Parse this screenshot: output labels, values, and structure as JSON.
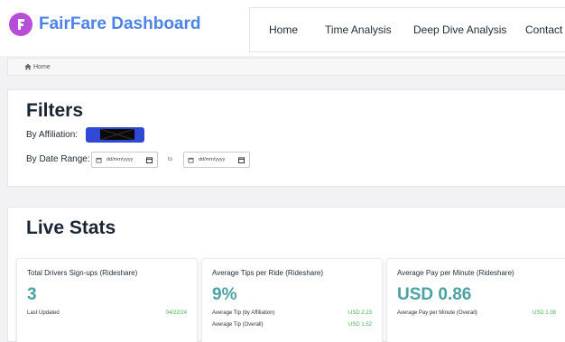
{
  "brand": {
    "name": "FairFare Dashboard",
    "logo_color": "#b84dd8",
    "name_color": "#4c83e6"
  },
  "nav": {
    "home": "Home",
    "time_analysis": "Time Analysis",
    "deep_dive": "Deep Dive Analysis",
    "contact": "Contact"
  },
  "breadcrumb": {
    "home": "Home"
  },
  "filters": {
    "title": "Filters",
    "affiliation_label": "By Affiliation:",
    "date_range_label": "By Date Range:",
    "date_from_placeholder": "dd/mm/yyyy",
    "to_label": "to",
    "date_to_placeholder": "dd/mm/yyyy",
    "affiliation_select_color": "#2f49d6"
  },
  "live_stats": {
    "title": "Live Stats",
    "cards": [
      {
        "title": "Total Drivers Sign-ups (Rideshare)",
        "value": "3",
        "rows": [
          {
            "label": "Last Updated",
            "value": "04/22/24"
          }
        ]
      },
      {
        "title": "Average Tips per Ride (Rideshare)",
        "value": "9%",
        "rows": [
          {
            "label": "Average Tip (by Affiliation)",
            "value": "USD 2.23"
          },
          {
            "label": "Average Tip (Overall)",
            "value": "USD 1.52"
          }
        ]
      },
      {
        "title": "Average Pay per Minute (Rideshare)",
        "value": "USD 0.86",
        "rows": [
          {
            "label": "Average Pay per Minute (Overall)",
            "value": "USD 1.08"
          }
        ]
      }
    ],
    "value_color": "#4aa3a1",
    "secondary_color": "#49b04f"
  }
}
